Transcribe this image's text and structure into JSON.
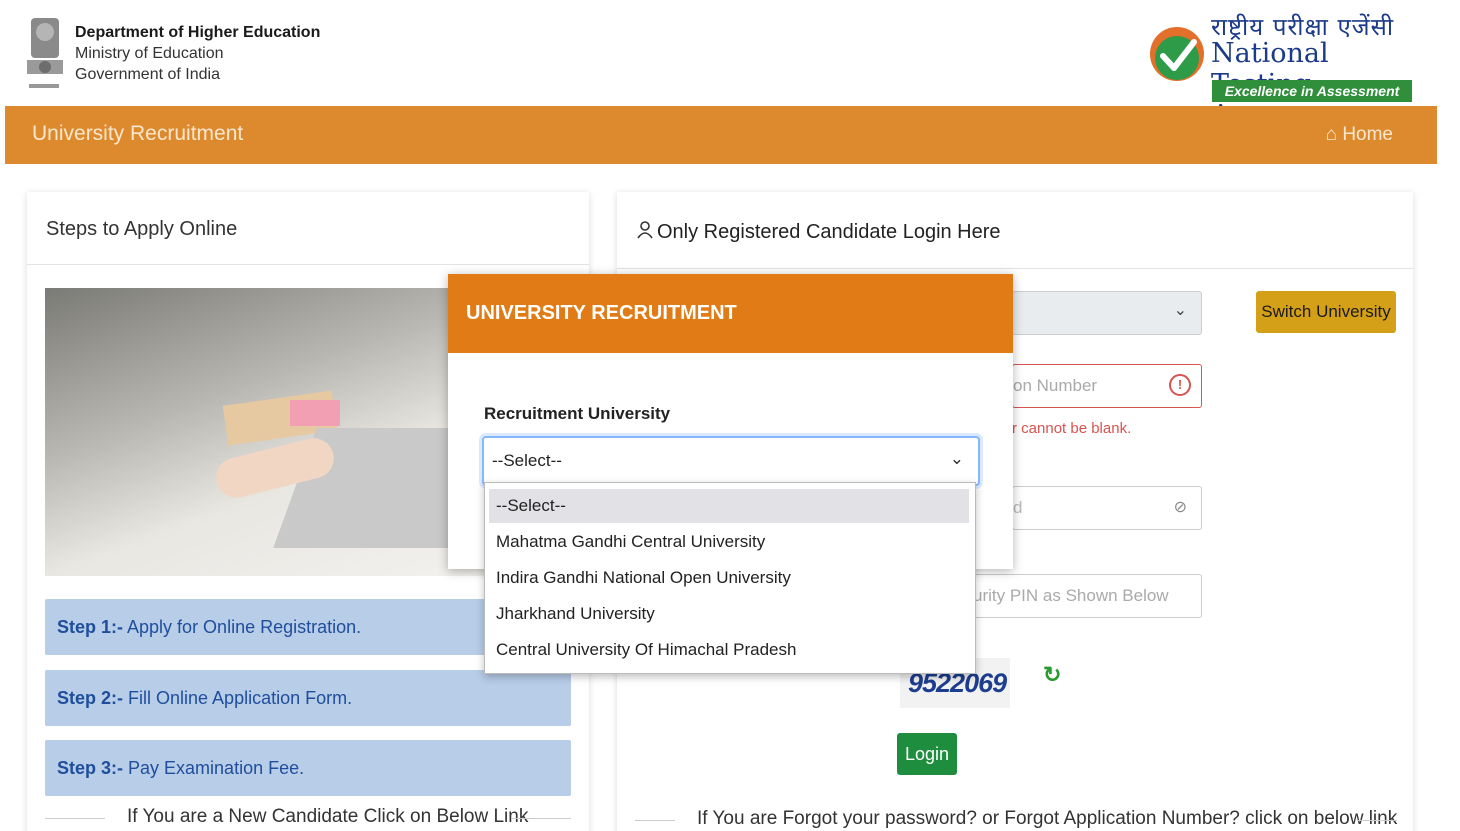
{
  "header": {
    "dept_name": "Department of Higher Education",
    "ministry": "Ministry of Education",
    "government": "Government of India",
    "nta_hindi": "राष्ट्रीय परीक्षा एजेंसी",
    "nta_english": "National Testing Agency",
    "nta_tagline": "Excellence in Assessment"
  },
  "nav": {
    "title": "University Recruitment",
    "home_label": "⌂ Home"
  },
  "left_card": {
    "title": "Steps to Apply Online",
    "steps": [
      {
        "label": "Step 1:-",
        "text": " Apply for Online Registration."
      },
      {
        "label": "Step 2:-",
        "text": " Fill Online Application Form."
      },
      {
        "label": "Step 3:-",
        "text": " Pay Examination Fee."
      }
    ],
    "new_candidate_text": "If You are a New Candidate Click on Below Link"
  },
  "right_card": {
    "title": "Only Registered Candidate Login Here",
    "switch_university": "Switch University",
    "application_number_placeholder": "on Number",
    "application_number_error": "r cannot be blank.",
    "password_placeholder": "d",
    "security_pin_placeholder": "urity PIN as Shown Below",
    "captcha_text": "9522069",
    "login_button": "Login",
    "forgot_text": "If You are Forgot your password? or Forgot Application Number? click on below link"
  },
  "modal": {
    "title": "UNIVERSITY RECRUITMENT",
    "field_label": "Recruitment University",
    "selected_value": "--Select--",
    "options": [
      "--Select--",
      "Mahatma Gandhi Central University",
      "Indira Gandhi National Open University",
      "Jharkhand University",
      "Central University Of Himachal Pradesh"
    ]
  },
  "colors": {
    "nav_bg": "#dd8a2e",
    "modal_header_bg": "#e07b16",
    "step_bg": "#b7cde8",
    "login_green": "#1e8e3e",
    "switch_gold": "#d4a017",
    "error_red": "#d9534f"
  },
  "icons": {
    "home": "home-icon",
    "user": "user-icon",
    "chevron": "chevron-down-icon",
    "error": "error-circle-icon",
    "eye": "eye-slash-icon",
    "refresh": "refresh-icon"
  }
}
